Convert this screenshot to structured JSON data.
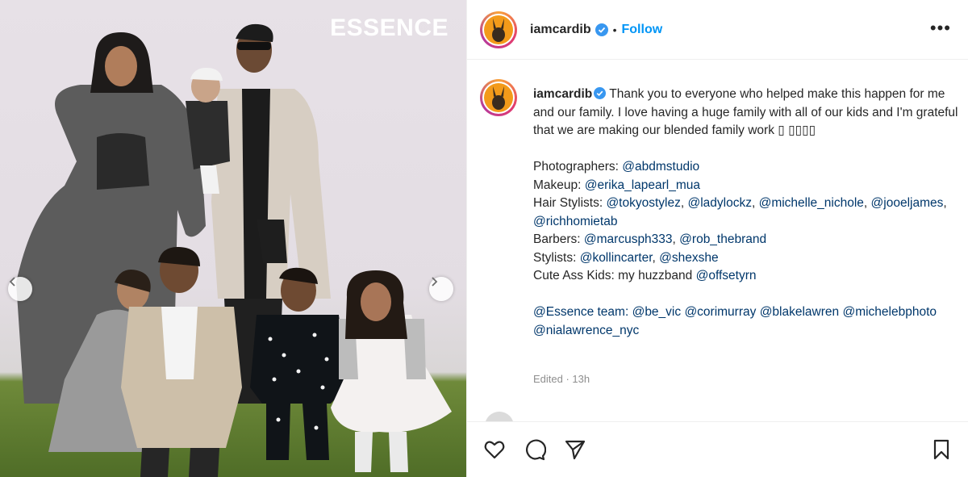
{
  "photo": {
    "magazine_label": "ESSENCE",
    "prev_icon": "chevron-left-icon",
    "next_icon": "chevron-right-icon"
  },
  "header": {
    "username": "iamcardib",
    "dot": "•",
    "follow_label": "Follow",
    "more_label": "•••"
  },
  "caption": {
    "username": "iamcardib",
    "intro": "Thank you to everyone who helped make this happen for me and our family. I love having a huge family with all of our kids and I'm grateful that we are making our blended family work ▯ ▯▯▯▯",
    "credits": [
      {
        "label": "Photographers: ",
        "tags": [
          "@abdmstudio"
        ]
      },
      {
        "label": "Makeup: ",
        "tags": [
          "@erika_lapearl_mua"
        ]
      },
      {
        "label": "Hair Stylists: ",
        "tags": [
          "@tokyostylez",
          "@ladylockz",
          "@michelle_nichole",
          "@jooeljames",
          "@richhomietab"
        ]
      },
      {
        "label": "Barbers: ",
        "tags": [
          "@marcusph333",
          "@rob_thebrand"
        ]
      },
      {
        "label": "Stylists: ",
        "tags": [
          "@kollincarter",
          "@shexshe"
        ]
      },
      {
        "label": "Cute Ass Kids: my huzzband ",
        "tags": [
          "@offsetyrn"
        ]
      }
    ],
    "essence_team": [
      "@Essence team:",
      "@be_vic",
      "@corimurray",
      "@blakelawren",
      "@michelebphoto",
      "@nialawrence_nyc"
    ],
    "edited": "Edited · 13h"
  },
  "actions": {
    "like_icon": "heart-icon",
    "comment_icon": "comment-icon",
    "share_icon": "send-icon",
    "save_icon": "bookmark-icon"
  },
  "colors": {
    "link": "#00376b",
    "follow": "#0095f6",
    "verified": "#3897f0",
    "muted": "#8e8e8e"
  }
}
